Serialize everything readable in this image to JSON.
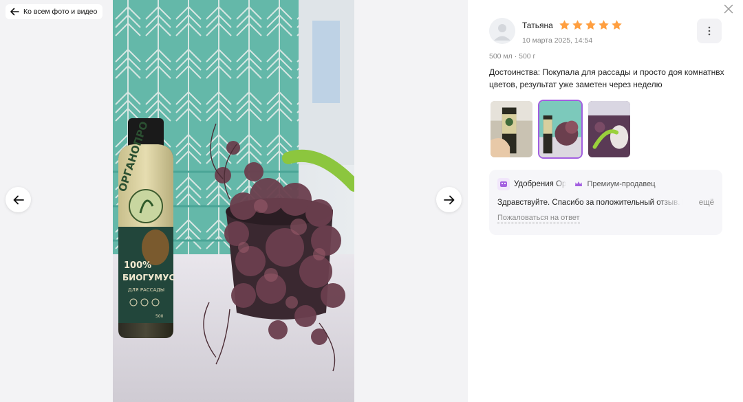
{
  "gallery": {
    "back_label": "Ко всем фото и видео",
    "photo_label_brand": "ОРГАНОПРО",
    "photo_label_percent": "100%",
    "photo_label_product": "БИОГУМУС",
    "photo_label_sub": "ДЛЯ РАССАДЫ",
    "photo_label_volume": "500"
  },
  "review": {
    "author": "Татьяна",
    "rating": 5,
    "date": "10 марта 2025, 14:54",
    "variant": "500 мл · 500 г",
    "text": "Достоинства: Покупала для рассады и просто доя комнатнвх цветов, результат уже заметен через неделю",
    "thumbnails": [
      {
        "selected": false
      },
      {
        "selected": true
      },
      {
        "selected": false
      }
    ],
    "star_color": "#ff9f40"
  },
  "answer": {
    "seller_name": "Удобрения Ор",
    "badge": "Премиум-продавец",
    "text": "Здравствуйте. Спасибо за положительный отзыв. Ва",
    "more": "ещё",
    "report": "Пожаловаться на ответ"
  },
  "colors": {
    "accent": "#a35ee0",
    "star": "#ff9f40",
    "panel_bg": "#f6f6f9"
  }
}
